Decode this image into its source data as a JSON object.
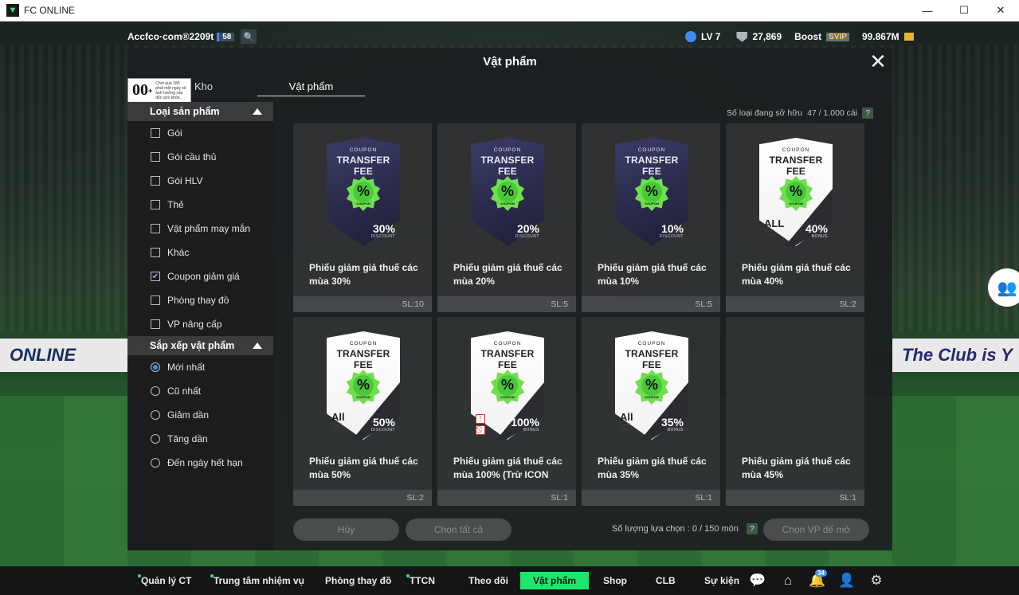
{
  "window": {
    "title": "FC ONLINE",
    "minimize": "—",
    "maximize": "☐",
    "close": "✕"
  },
  "hud": {
    "account": "Accfco·com®2209t",
    "account_level": "58",
    "level": "LV 7",
    "trophies": "27,869",
    "boost": "Boost",
    "svip": "SVIP",
    "balance": "99.867M"
  },
  "modal": {
    "title": "Vật phẩm",
    "age_rating": "00",
    "age_text": "Chơi quá 180 phút một ngày sẽ ảnh hưởng xấu đến sức khỏe.",
    "tabs": [
      "Kho",
      "Vật phẩm"
    ],
    "owned_label": "Số loại đang sở hữu",
    "owned_value": "47 / 1.000 cái",
    "help": "?"
  },
  "sidebar": {
    "product_type_header": "Loại sản phẩm",
    "product_types": [
      {
        "label": "Gói",
        "checked": false
      },
      {
        "label": "Gói cầu thủ",
        "checked": false
      },
      {
        "label": "Gói HLV",
        "checked": false
      },
      {
        "label": "Thẻ",
        "checked": false
      },
      {
        "label": "Vật phẩm may mắn",
        "checked": false
      },
      {
        "label": "Khác",
        "checked": false
      },
      {
        "label": "Coupon giảm giá",
        "checked": true
      },
      {
        "label": "Phòng thay đồ",
        "checked": false
      },
      {
        "label": "VP nâng cấp",
        "checked": false
      }
    ],
    "sort_header": "Sắp xếp vật phẩm",
    "sort_options": [
      {
        "label": "Mới nhất",
        "selected": true
      },
      {
        "label": "Cũ nhất",
        "selected": false
      },
      {
        "label": "Giảm dần",
        "selected": false
      },
      {
        "label": "Tăng dần",
        "selected": false
      },
      {
        "label": "Đến ngày hết hạn",
        "selected": false
      }
    ]
  },
  "items": [
    {
      "name": "Phiếu giảm giá thuế các mùa 30%",
      "qty": "SL:10",
      "style": "dark",
      "coupon": "COUPON",
      "title": "TRANSFER FEE",
      "value": "30%",
      "sub": "DISCOUNT"
    },
    {
      "name": "Phiếu giảm giá thuế các mùa 20%",
      "qty": "SL:5",
      "style": "dark",
      "coupon": "COUPON",
      "title": "TRANSFER FEE",
      "value": "20%",
      "sub": "DISCOUNT"
    },
    {
      "name": "Phiếu giảm giá thuế các mùa 10%",
      "qty": "SL:5",
      "style": "dark",
      "coupon": "COUPON",
      "title": "TRANSFER FEE",
      "value": "10%",
      "sub": "DISCOUNT"
    },
    {
      "name": "Phiếu giảm giá thuế các mùa 40%",
      "qty": "SL:2",
      "style": "white",
      "coupon": "COUPON",
      "title": "TRANSFER FEE",
      "value": "40%",
      "sub": "BONUS",
      "all": "ALL"
    },
    {
      "name": "Phiếu giảm giá thuế các mùa 50%",
      "qty": "SL:2",
      "style": "white",
      "coupon": "COUPON",
      "title": "TRANSFER FEE",
      "value": "50%",
      "sub": "DISCOUNT",
      "all": "All"
    },
    {
      "name": "Phiếu giảm giá thuế các mùa 100% (Trừ ICON",
      "qty": "SL:1",
      "style": "white",
      "coupon": "COUPON",
      "title": "TRANSFER FEE",
      "value": "100%",
      "sub": "BONUS",
      "icons": true
    },
    {
      "name": "Phiếu giảm giá thuế các mùa 35%",
      "qty": "SL:1",
      "style": "white",
      "coupon": "COUPON",
      "title": "TRANSFER FEE",
      "value": "35%",
      "sub": "BONUS",
      "all": "All"
    },
    {
      "name": "Phiếu giảm giá thuế các mùa 45%",
      "qty": "SL:1",
      "style": "none"
    }
  ],
  "footer": {
    "cancel": "Hủy",
    "select_all": "Chọn tất cả",
    "selected_label": "Số lượng lựa chọn : 0 / 150 món",
    "open": "Chọn VP để mở"
  },
  "bottom_nav": [
    {
      "label": "Quản lý CT",
      "dot": true
    },
    {
      "label": "Trung tâm nhiệm vụ",
      "dot": true
    },
    {
      "label": "Phòng thay đồ",
      "dot": false
    },
    {
      "label": "TTCN",
      "dot": true
    },
    {
      "label": "Theo dõi",
      "dot": false
    },
    {
      "label": "Vật phẩm",
      "dot": false,
      "active": true
    },
    {
      "label": "Shop",
      "dot": false
    },
    {
      "label": "CLB",
      "dot": false
    },
    {
      "label": "Sự kiện",
      "dot": false
    }
  ],
  "notification_count": "34",
  "banner_left": "ONLINE",
  "banner_right": "The Club is Y",
  "colors": {
    "accent": "#1fe56d",
    "coupon_green": "#6ee04b",
    "check_blue": "#3d8bff"
  }
}
